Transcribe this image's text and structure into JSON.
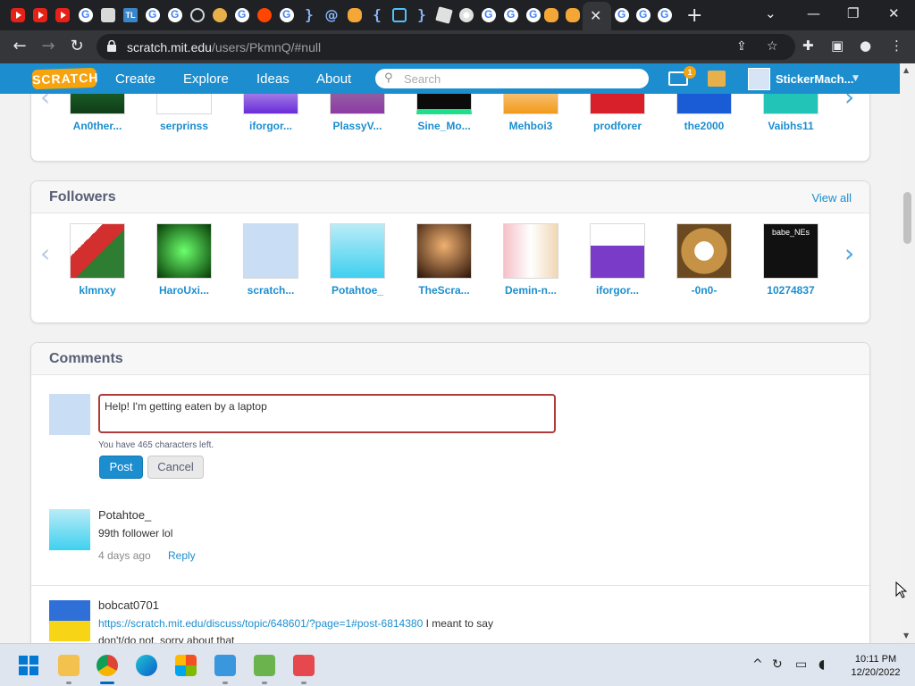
{
  "browser": {
    "url_host": "scratch.mit.edu",
    "url_path": "/users/PkmnQ/#null",
    "tab_label_tl": "TL"
  },
  "scratch_nav": {
    "logo": "SCRATCH",
    "links": [
      "Create",
      "Explore",
      "Ideas",
      "About"
    ],
    "search_placeholder": "Search",
    "message_count": "1",
    "username": "StickerMach..."
  },
  "following": {
    "users": [
      "An0ther...",
      "serprinss",
      "iforgor...",
      "PlassyV...",
      "Sine_Mo...",
      "Mehboi3",
      "prodforer",
      "the2000",
      "Vaibhs11"
    ]
  },
  "followers": {
    "title": "Followers",
    "view_all": "View all",
    "users": [
      "klmnxy",
      "HaroUxi...",
      "scratch...",
      "Potahtoe_",
      "TheScra...",
      "Demin-n...",
      "iforgor...",
      "-0n0-",
      "10274837"
    ],
    "tile_caption_10274837": "babe_NEs"
  },
  "comments": {
    "title": "Comments",
    "draft_text": "Help! I'm getting eaten by a laptop",
    "chars_left": "You have 465 characters left.",
    "post_label": "Post",
    "cancel_label": "Cancel",
    "items": [
      {
        "author": "Potahtoe_",
        "text": "99th follower lol",
        "time": "4 days ago",
        "reply": "Reply"
      },
      {
        "author": "bobcat0701",
        "link": "https://scratch.mit.edu/discuss/topic/648601/?page=1#post-6814380",
        "text_after_link": " I meant to say",
        "text_line2": "don't/do not, sorry about that"
      }
    ]
  },
  "taskbar": {
    "time": "10:11 PM",
    "date": "12/20/2022"
  },
  "colors": {
    "scratch_blue": "#1c8ecf",
    "scratch_orange": "#f6a30e",
    "text_gray": "#575e75",
    "comment_border_red": "#b13a3a"
  }
}
